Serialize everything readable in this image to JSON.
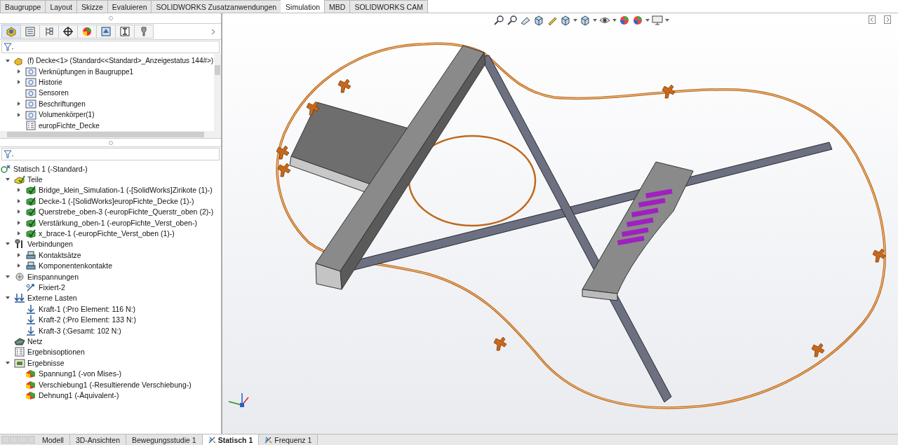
{
  "ribbon_tabs": [
    {
      "label": "Baugruppe",
      "selected": false
    },
    {
      "label": "Layout",
      "selected": false
    },
    {
      "label": "Skizze",
      "selected": false
    },
    {
      "label": "Evaluieren",
      "selected": false
    },
    {
      "label": "SOLIDWORKS Zusatzanwendungen",
      "selected": false
    },
    {
      "label": "Simulation",
      "selected": true
    },
    {
      "label": "MBD",
      "selected": false
    },
    {
      "label": "SOLIDWORKS CAM",
      "selected": false
    }
  ],
  "panel_tabs": [
    {
      "kind": "feature",
      "selected": true
    },
    {
      "kind": "property",
      "selected": false
    },
    {
      "kind": "config",
      "selected": false
    },
    {
      "kind": "dim",
      "selected": false
    },
    {
      "kind": "display",
      "selected": false
    },
    {
      "kind": "cam",
      "selected": false
    },
    {
      "kind": "sim",
      "selected": false
    },
    {
      "kind": "tool",
      "selected": false
    }
  ],
  "feature_tree": [
    {
      "label": "(f) Decke<1> (Standard<<Standard>_Anzeigestatus 144#>)",
      "kind": "assembly",
      "expanded": true,
      "children": [
        {
          "label": "Verknüpfungen in Baugruppe1",
          "kind": "folder",
          "expanded": false
        },
        {
          "label": "Historie",
          "kind": "folder",
          "expanded": false
        },
        {
          "label": "Sensoren",
          "kind": "sensor"
        },
        {
          "label": "Beschriftungen",
          "kind": "annotation",
          "expanded": false
        },
        {
          "label": "Volumenkörper(1)",
          "kind": "body",
          "expanded": false
        },
        {
          "label": "europFichte_Decke",
          "kind": "options"
        }
      ]
    }
  ],
  "simulation_tree": [
    {
      "label": "Statisch 1 (-Standard-)",
      "kind": "study",
      "children": [
        {
          "label": "Teile",
          "kind": "parts",
          "expanded": true,
          "children": [
            {
              "label": "Bridge_klein_Simulation-1 (-[SolidWorks]Zirikote (1)-)",
              "kind": "part",
              "expanded": false
            },
            {
              "label": "Decke-1 (-[SolidWorks]europFichte_Decke (1)-)",
              "kind": "part",
              "expanded": false
            },
            {
              "label": "Querstrebe_oben-3 (-europFichte_Querstr_oben (2)-)",
              "kind": "part",
              "expanded": false
            },
            {
              "label": "Verstärkung_oben-1 (-europFichte_Verst_oben-)",
              "kind": "part",
              "expanded": false
            },
            {
              "label": "x_brace-1 (-europFichte_Verst_oben (1)-)",
              "kind": "part",
              "expanded": false
            }
          ]
        },
        {
          "label": "Verbindungen",
          "kind": "connections",
          "expanded": true,
          "children": [
            {
              "label": "Kontaktsätze",
              "kind": "contact",
              "expanded": false
            },
            {
              "label": "Komponentenkontakte",
              "kind": "contact",
              "expanded": false
            }
          ]
        },
        {
          "label": "Einspannungen",
          "kind": "fixtures",
          "expanded": true,
          "children": [
            {
              "label": "Fixiert-2",
              "kind": "fixed"
            }
          ]
        },
        {
          "label": "Externe Lasten",
          "kind": "loads",
          "expanded": true,
          "children": [
            {
              "label": "Kraft-1 (:Pro Element: 116 N:)",
              "kind": "force"
            },
            {
              "label": "Kraft-2 (:Pro Element: 133 N:)",
              "kind": "force"
            },
            {
              "label": "Kraft-3 (:Gesamt: 102 N:)",
              "kind": "force"
            }
          ]
        },
        {
          "label": "Netz",
          "kind": "mesh"
        },
        {
          "label": "Ergebnisoptionen",
          "kind": "options"
        },
        {
          "label": "Ergebnisse",
          "kind": "results",
          "expanded": true,
          "children": [
            {
              "label": "Spannung1 (-von Mises-)",
              "kind": "plot"
            },
            {
              "label": "Verschiebung1 (-Resultierende Verschiebung-)",
              "kind": "plot"
            },
            {
              "label": "Dehnung1 (-Äquivalent-)",
              "kind": "plot"
            }
          ]
        }
      ]
    }
  ],
  "bottom_tabs": [
    {
      "label": "Modell",
      "kind": "plain",
      "selected": false
    },
    {
      "label": "3D-Ansichten",
      "kind": "plain",
      "selected": false
    },
    {
      "label": "Bewegungsstudie 1",
      "kind": "plain",
      "selected": false
    },
    {
      "label": "Statisch 1",
      "kind": "study",
      "selected": true
    },
    {
      "label": "Frequenz 1",
      "kind": "study",
      "selected": false
    }
  ]
}
